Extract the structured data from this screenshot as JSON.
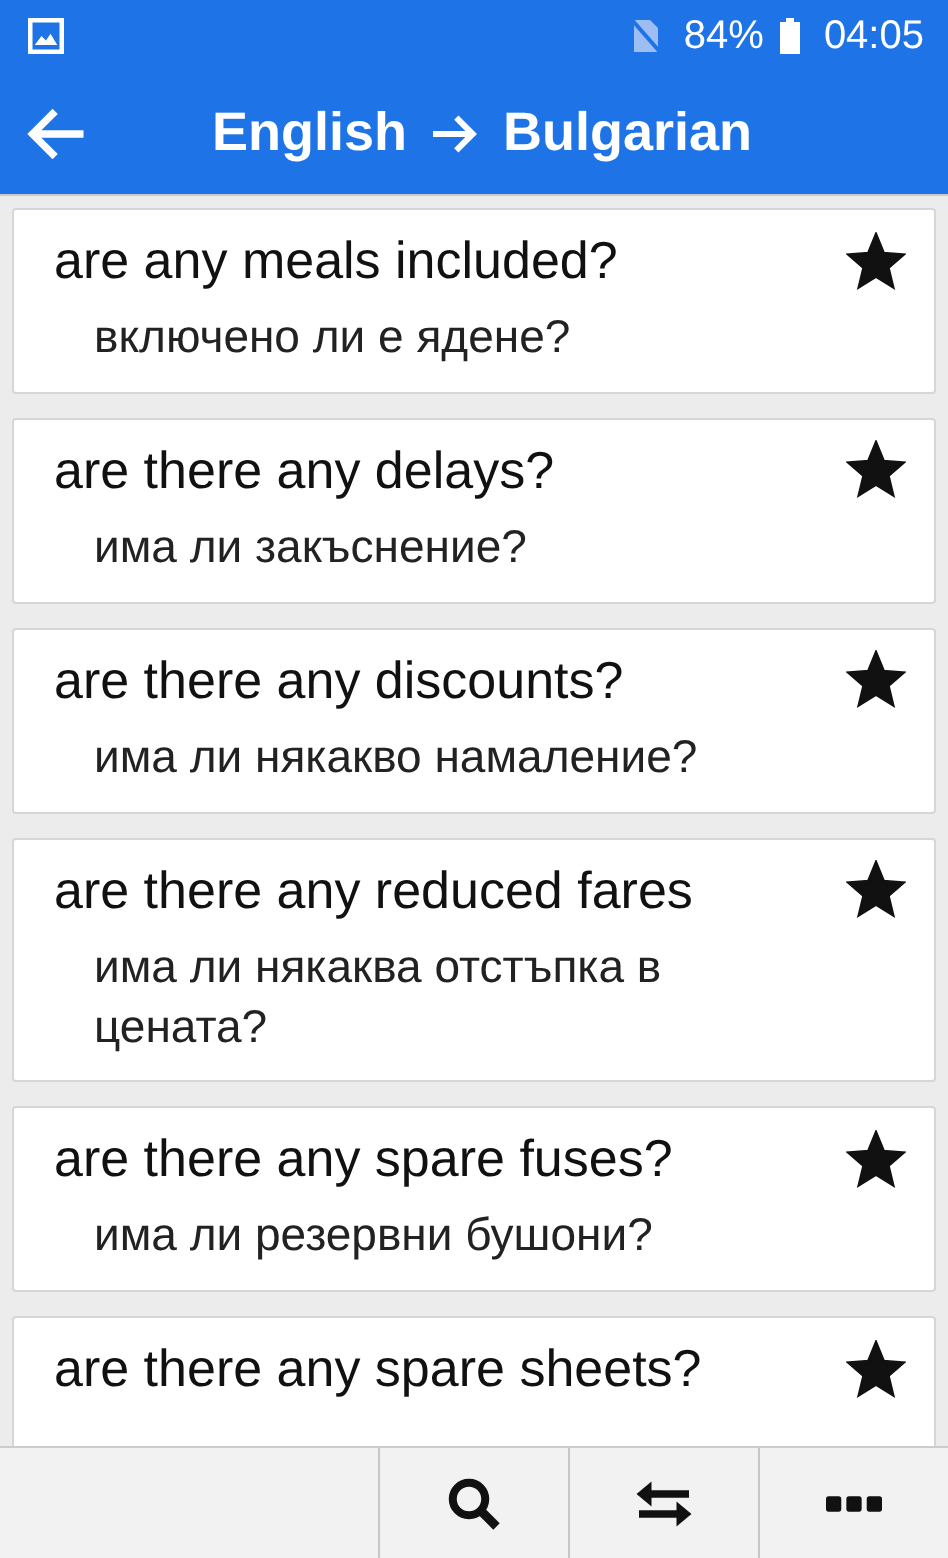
{
  "status_bar": {
    "battery": "84%",
    "time": "04:05"
  },
  "app_bar": {
    "source": "English",
    "target": "Bulgarian"
  },
  "phrases": [
    {
      "english": "are any meals included?",
      "translation": "включено ли е ядене?",
      "starred": true
    },
    {
      "english": "are there any delays?",
      "translation": "има ли закъснение?",
      "starred": true
    },
    {
      "english": "are there any discounts?",
      "translation": "има ли някакво намаление?",
      "starred": true
    },
    {
      "english": "are there any reduced fares",
      "translation": "има ли някаква отстъпка в цената?",
      "starred": true
    },
    {
      "english": "are there any spare fuses?",
      "translation": "има ли резервни бушони?",
      "starred": true
    },
    {
      "english": "are there any spare sheets?",
      "starred": true
    }
  ]
}
